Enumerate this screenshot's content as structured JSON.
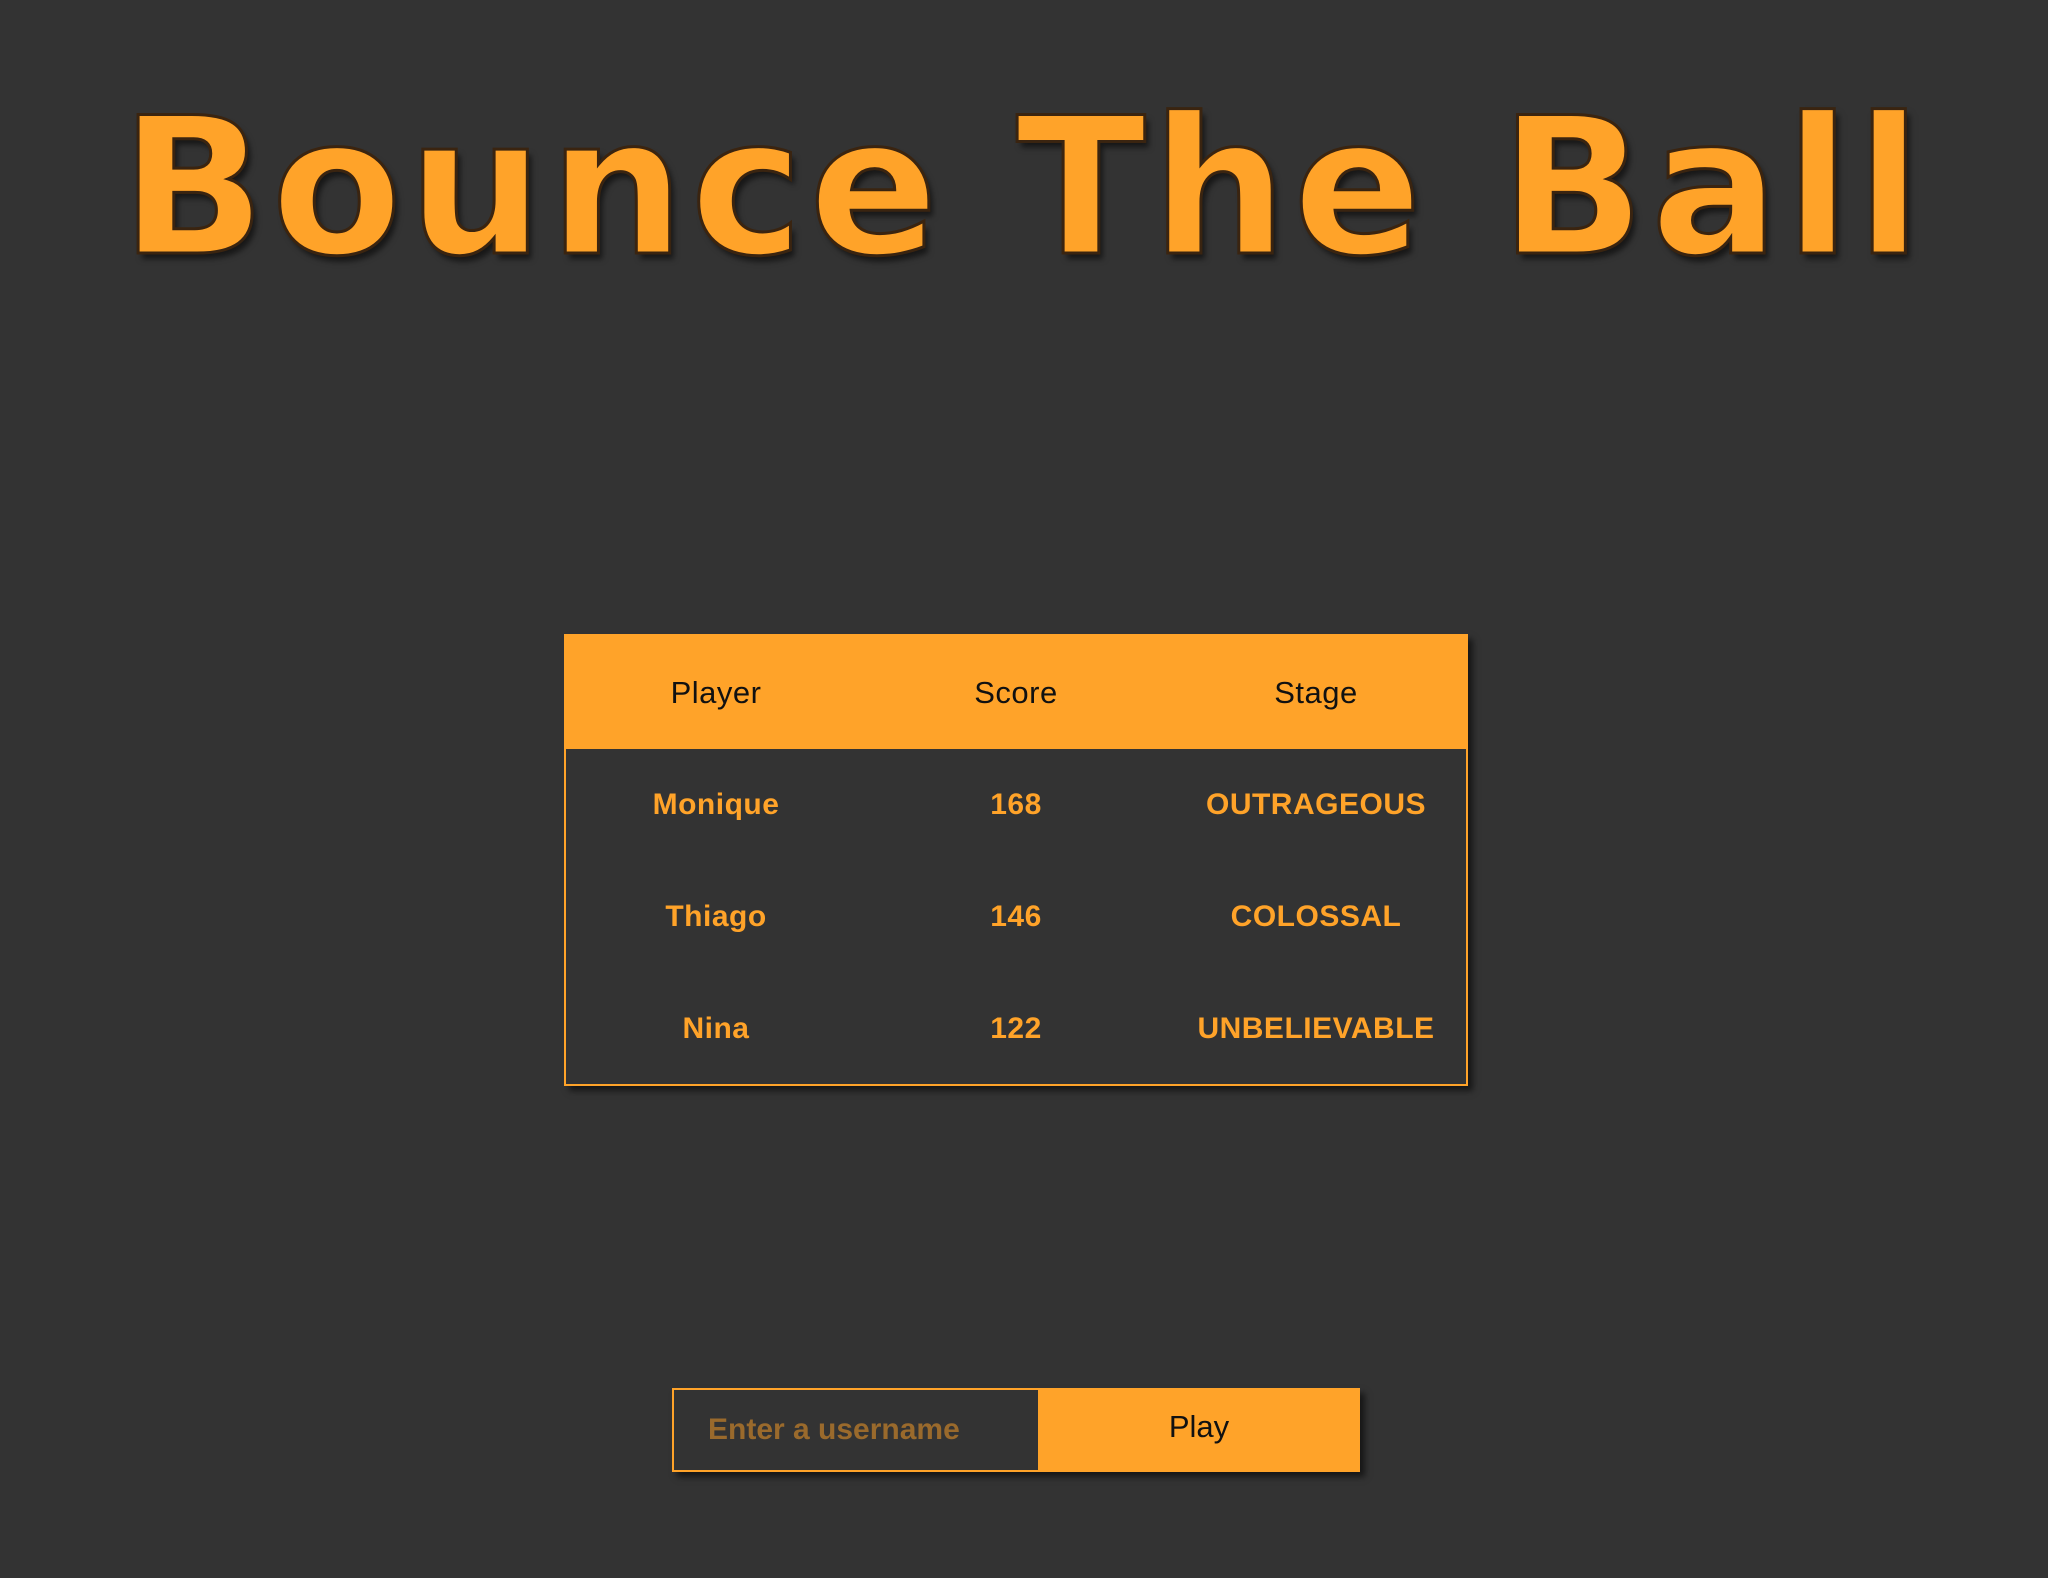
{
  "game": {
    "title": "Bounce The Ball"
  },
  "leaderboard": {
    "headers": {
      "player": "Player",
      "score": "Score",
      "stage": "Stage"
    },
    "rows": [
      {
        "player": "Monique",
        "score": "168",
        "stage": "OUTRAGEOUS"
      },
      {
        "player": "Thiago",
        "score": "146",
        "stage": "COLOSSAL"
      },
      {
        "player": "Nina",
        "score": "122",
        "stage": "UNBELIEVABLE"
      }
    ]
  },
  "form": {
    "username_placeholder": "Enter a username",
    "play_label": "Play"
  },
  "colors": {
    "background": "#333333",
    "accent": "#ffa329",
    "header_text": "#111111"
  }
}
